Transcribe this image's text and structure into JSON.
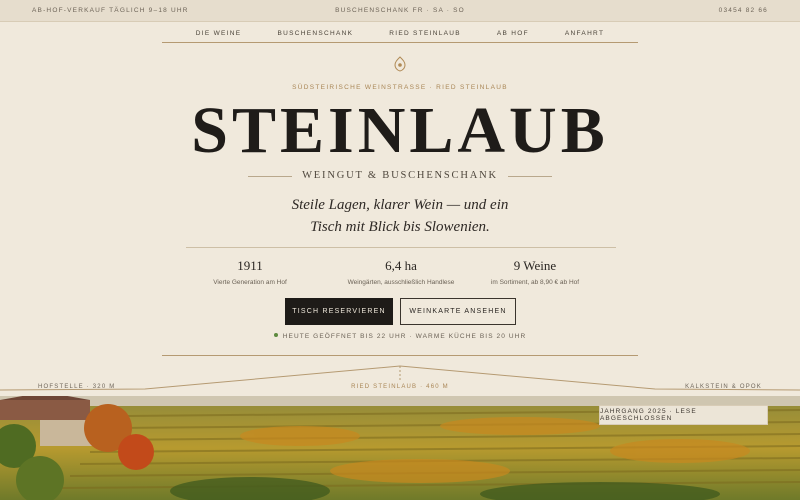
{
  "topbar": {
    "left": "Ab-Hof-Verkauf täglich 9–18 Uhr",
    "center": "Buschenschank Fr · Sa · So",
    "right": "03454 82 66"
  },
  "nav": [
    "Die Weine",
    "Buschenschank",
    "Ried Steinlaub",
    "Ab Hof",
    "Anfahrt"
  ],
  "hero": {
    "eyebrow": "Südsteirische Weinstrasse · Ried Steinlaub",
    "title": "STEINLAUB",
    "subtitle": "Weingut & Buschenschank",
    "tagline_line1": "Steile Lagen, klarer Wein — und ein",
    "tagline_line2": "Tisch mit Blick bis Slowenien."
  },
  "stats": [
    {
      "value": "1911",
      "label": "Vierte Generation am Hof"
    },
    {
      "value": "6,4 ha",
      "label": "Weingärten, ausschließlich Handlese"
    },
    {
      "value": "9 Weine",
      "label": "im Sortiment, ab 8,90 € ab Hof"
    }
  ],
  "buttons": {
    "primary": "Tisch reservieren",
    "secondary": "Weinkarte ansehen"
  },
  "status": {
    "text": "Heute geöffnet bis 22 Uhr · Warme Küche bis 20 Uhr",
    "color": "#5d8a3e"
  },
  "profile": {
    "left": "Hofstelle · 320 m",
    "center": "Ried Steinlaub · 460 m",
    "right": "Kalkstein & Opok"
  },
  "badge": "Jahrgang 2025 · Lese abgeschlossen",
  "colors": {
    "background": "#f0e9dc",
    "accent": "#b59a72",
    "primary_button": "#1e1b18"
  }
}
